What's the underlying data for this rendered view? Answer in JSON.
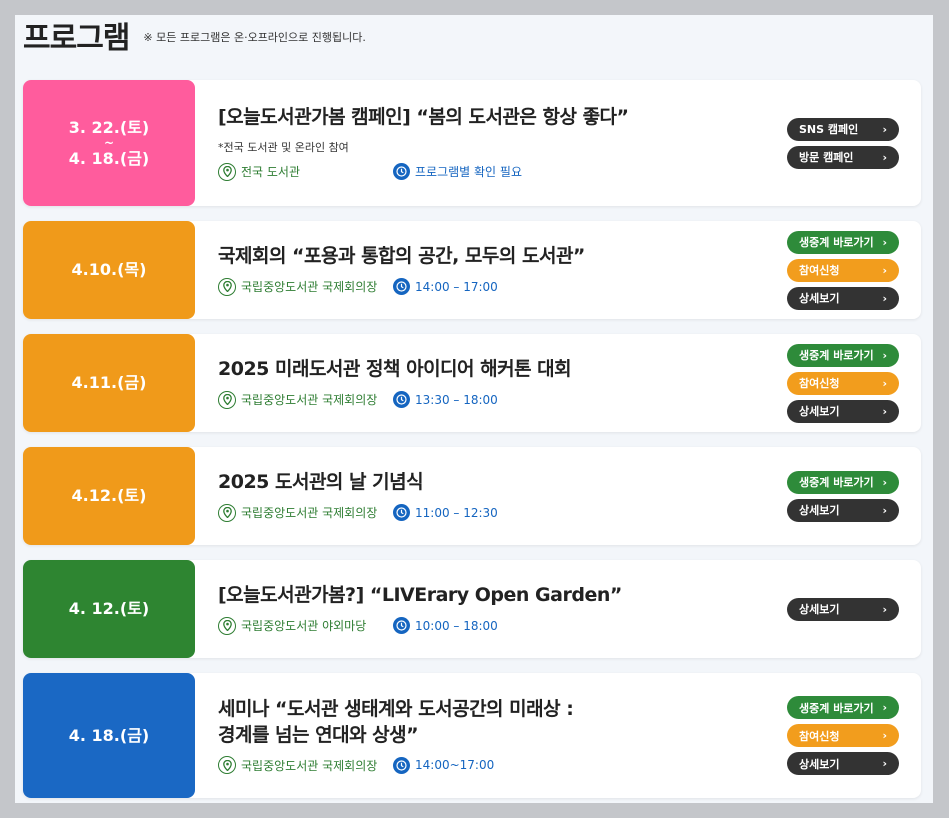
{
  "header": {
    "title": "프로그램",
    "note": "※ 모든 프로그램은 온·오프라인으로 진행됩니다."
  },
  "colors": {
    "pink": "#ff5c9d",
    "orange": "#f09a1a",
    "green": "#2e8531",
    "blue": "#1a68c4"
  },
  "programs": [
    {
      "date_start": "3. 22.(토)",
      "date_tilde": "~",
      "date_end": "4. 18.(금)",
      "title": "[오늘도서관가봄 캠페인] “봄의 도서관은 항상 좋다”",
      "note": "*전국 도서관 및 온라인 참여",
      "location": "전국 도서관",
      "time": "프로그램별 확인 필요",
      "buttons": [
        "SNS 캠페인",
        "방문 캠페인"
      ]
    },
    {
      "date": "4.10.(목)",
      "title": "국제회의 “포용과 통합의 공간, 모두의 도서관”",
      "location": "국립중앙도서관 국제회의장",
      "time": "14:00 – 17:00",
      "buttons": [
        "생중계 바로가기",
        "참여신청",
        "상세보기"
      ]
    },
    {
      "date": "4.11.(금)",
      "title": "2025 미래도서관 정책 아이디어 해커톤 대회",
      "location": "국립중앙도서관 국제회의장",
      "time": "13:30 – 18:00",
      "buttons": [
        "생중계 바로가기",
        "참여신청",
        "상세보기"
      ]
    },
    {
      "date": "4.12.(토)",
      "title": "2025 도서관의 날 기념식",
      "location": "국립중앙도서관 국제회의장",
      "time": "11:00 – 12:30",
      "buttons": [
        "생중계 바로가기",
        "상세보기"
      ]
    },
    {
      "date": "4. 12.(토)",
      "title": "[오늘도서관가봄?] “LIVErary Open Garden”",
      "location": "국립중앙도서관 야외마당",
      "time": "10:00 – 18:00",
      "buttons": [
        "상세보기"
      ]
    },
    {
      "date": "4. 18.(금)",
      "title_line1": "세미나 “도서관 생태계와 도서공간의 미래상 :",
      "title_line2": "경계를 넘는 연대와 상생”",
      "location": "국립중앙도서관 국제회의장",
      "time": "14:00~17:00",
      "buttons": [
        "생중계 바로가기",
        "참여신청",
        "상세보기"
      ]
    }
  ],
  "icons": {
    "location": "map-pin-icon",
    "time": "clock-icon",
    "button_arrow": "chevron-right-icon"
  }
}
